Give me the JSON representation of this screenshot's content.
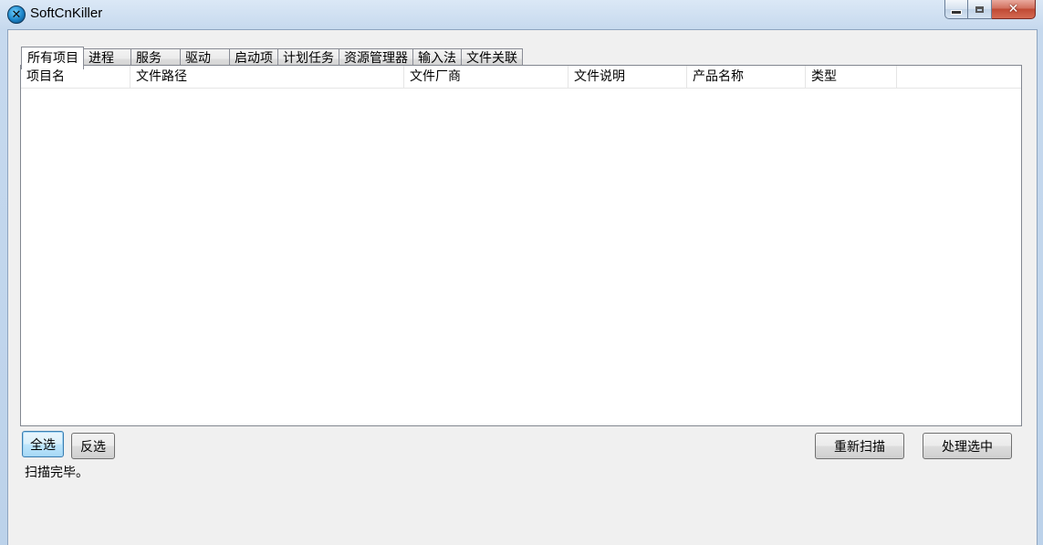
{
  "window": {
    "title": "SoftCnKiller",
    "icon": "softcnkiller-logo-icon",
    "controls": [
      "minimize-icon",
      "maximize-icon",
      "close-icon"
    ]
  },
  "tabs": [
    {
      "label": "所有项目",
      "active": true
    },
    {
      "label": "进程",
      "active": false
    },
    {
      "label": "服务",
      "active": false
    },
    {
      "label": "驱动",
      "active": false
    },
    {
      "label": "启动项",
      "active": false
    },
    {
      "label": "计划任务",
      "active": false
    },
    {
      "label": "资源管理器",
      "active": false
    },
    {
      "label": "输入法",
      "active": false
    },
    {
      "label": "文件关联",
      "active": false
    }
  ],
  "list": {
    "columns": [
      "项目名",
      "文件路径",
      "文件厂商",
      "文件说明",
      "产品名称",
      "类型"
    ],
    "rows": []
  },
  "buttons": {
    "select_all": "全选",
    "invert": "反选",
    "rescan": "重新扫描",
    "process": "处理选中"
  },
  "status": "扫描完毕。"
}
